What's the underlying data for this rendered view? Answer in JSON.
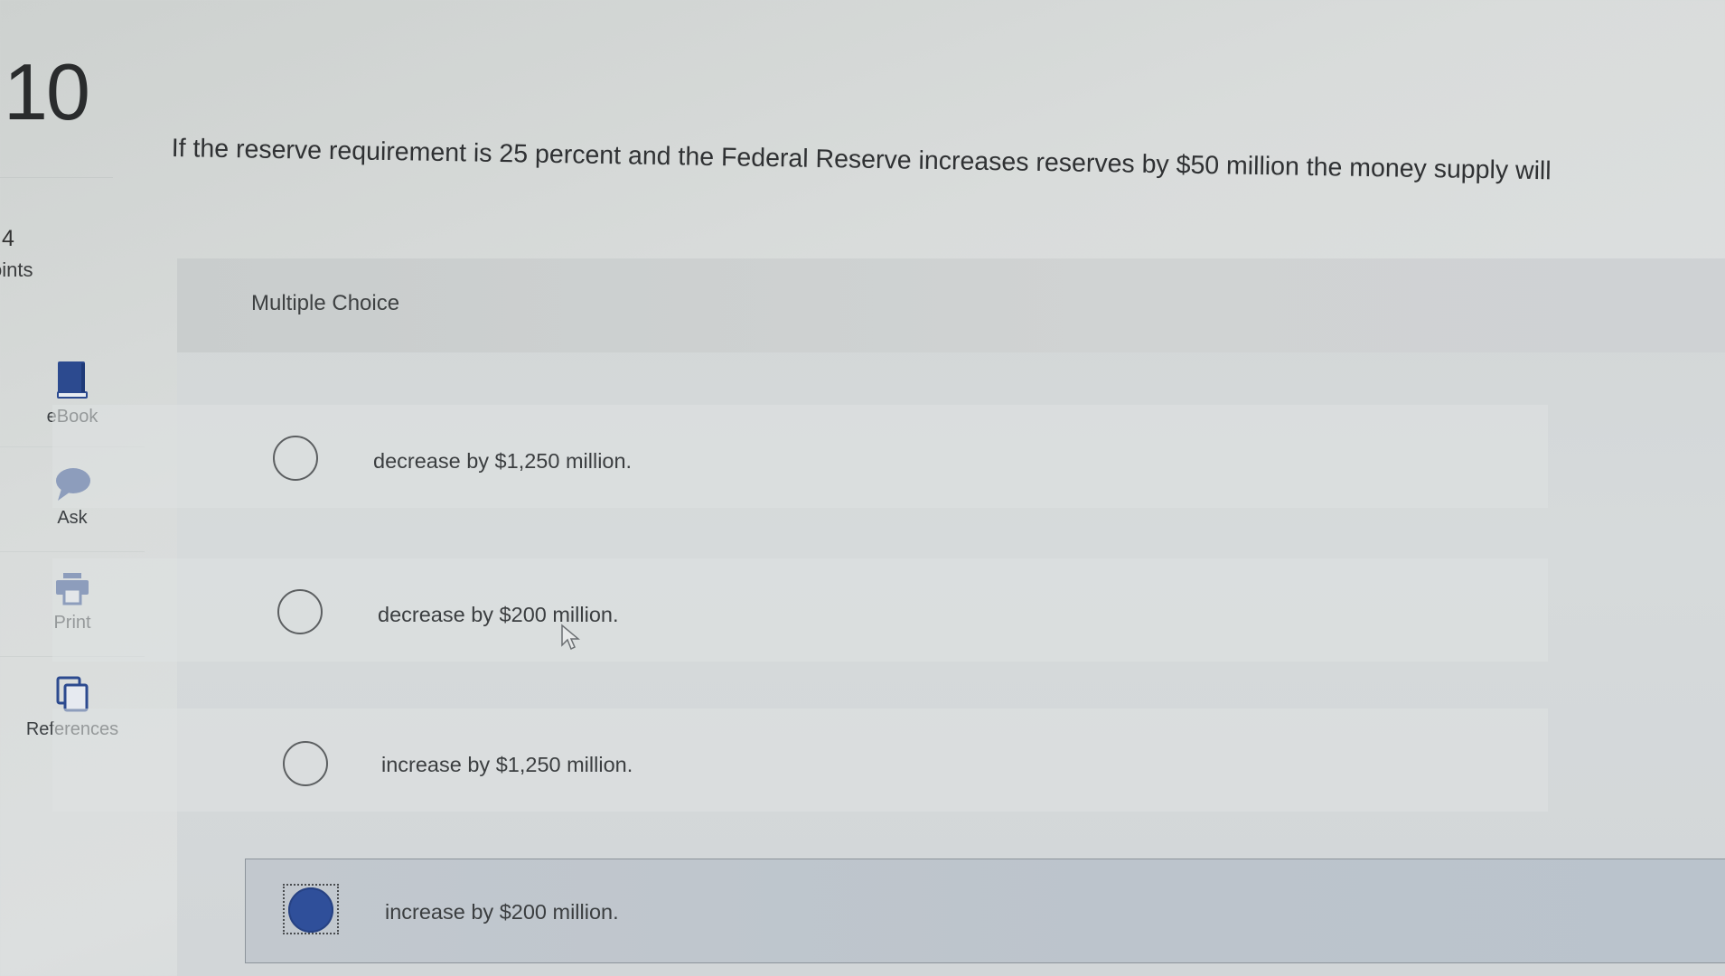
{
  "question": {
    "number": "10",
    "points_value": "4",
    "points_label": "oints",
    "prompt": "If the reserve requirement is 25 percent and the Federal Reserve increases reserves by $50 million the money supply will"
  },
  "tools": [
    {
      "label": "eBook",
      "icon": "book-icon",
      "color": "#2c4a8f"
    },
    {
      "label": "Ask",
      "icon": "chat-bubble-icon",
      "color": "#2c4a8f"
    },
    {
      "label": "Print",
      "icon": "printer-icon",
      "color": "#2c4a8f"
    },
    {
      "label": "References",
      "icon": "copy-pages-icon",
      "color": "#2c4a8f"
    }
  ],
  "choice_panel": {
    "title": "Multiple Choice",
    "options": [
      {
        "label": "decrease by $1,250 million.",
        "selected": false
      },
      {
        "label": "decrease by $200 million.",
        "selected": false
      },
      {
        "label": "increase by $1,250 million.",
        "selected": false
      },
      {
        "label": "increase by $200 million.",
        "selected": true
      }
    ]
  },
  "colors": {
    "accent": "#2f4f9a",
    "selected_bg": "#bcc4cc"
  }
}
